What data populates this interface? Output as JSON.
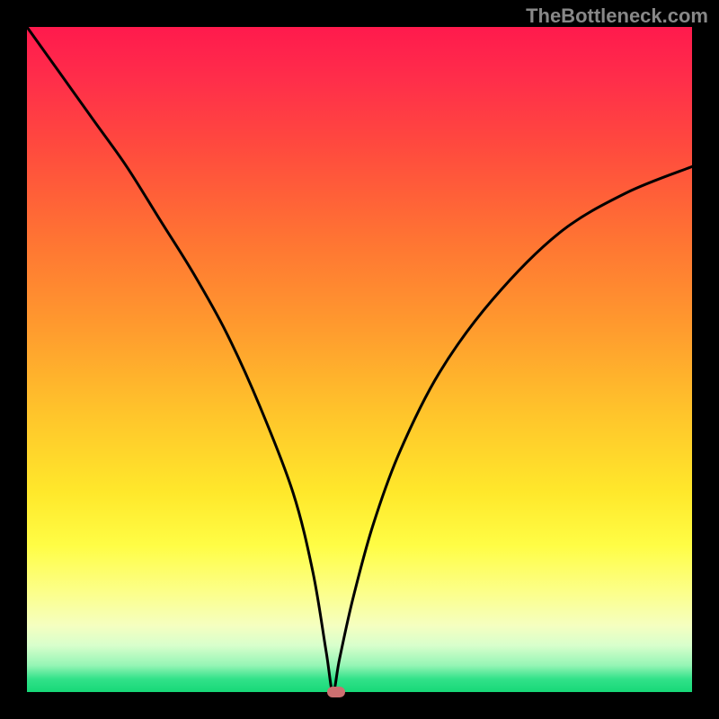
{
  "watermark": "TheBottleneck.com",
  "chart_data": {
    "type": "line",
    "title": "",
    "xlabel": "",
    "ylabel": "",
    "xlim": [
      0,
      100
    ],
    "ylim": [
      0,
      100
    ],
    "description": "V-shaped bottleneck curve on rainbow gradient background. The curve descends steeply from upper-left, reaches a minimum near x≈46, then rises more gradually toward the right edge.",
    "series": [
      {
        "name": "bottleneck-curve",
        "x": [
          0,
          5,
          10,
          15,
          20,
          25,
          30,
          35,
          40,
          43,
          45,
          46,
          47,
          49,
          52,
          56,
          62,
          70,
          80,
          90,
          100
        ],
        "values": [
          100,
          93,
          86,
          79,
          71,
          63,
          54,
          43,
          30,
          18,
          6,
          0,
          5,
          14,
          25,
          36,
          48,
          59,
          69,
          75,
          79
        ]
      }
    ],
    "marker": {
      "x": 46.5,
      "y": 0
    },
    "gradient_stops": [
      {
        "pos": 0,
        "color": "#ff1a4d"
      },
      {
        "pos": 50,
        "color": "#ffaa2e"
      },
      {
        "pos": 78,
        "color": "#fffd45"
      },
      {
        "pos": 100,
        "color": "#16d877"
      }
    ]
  }
}
